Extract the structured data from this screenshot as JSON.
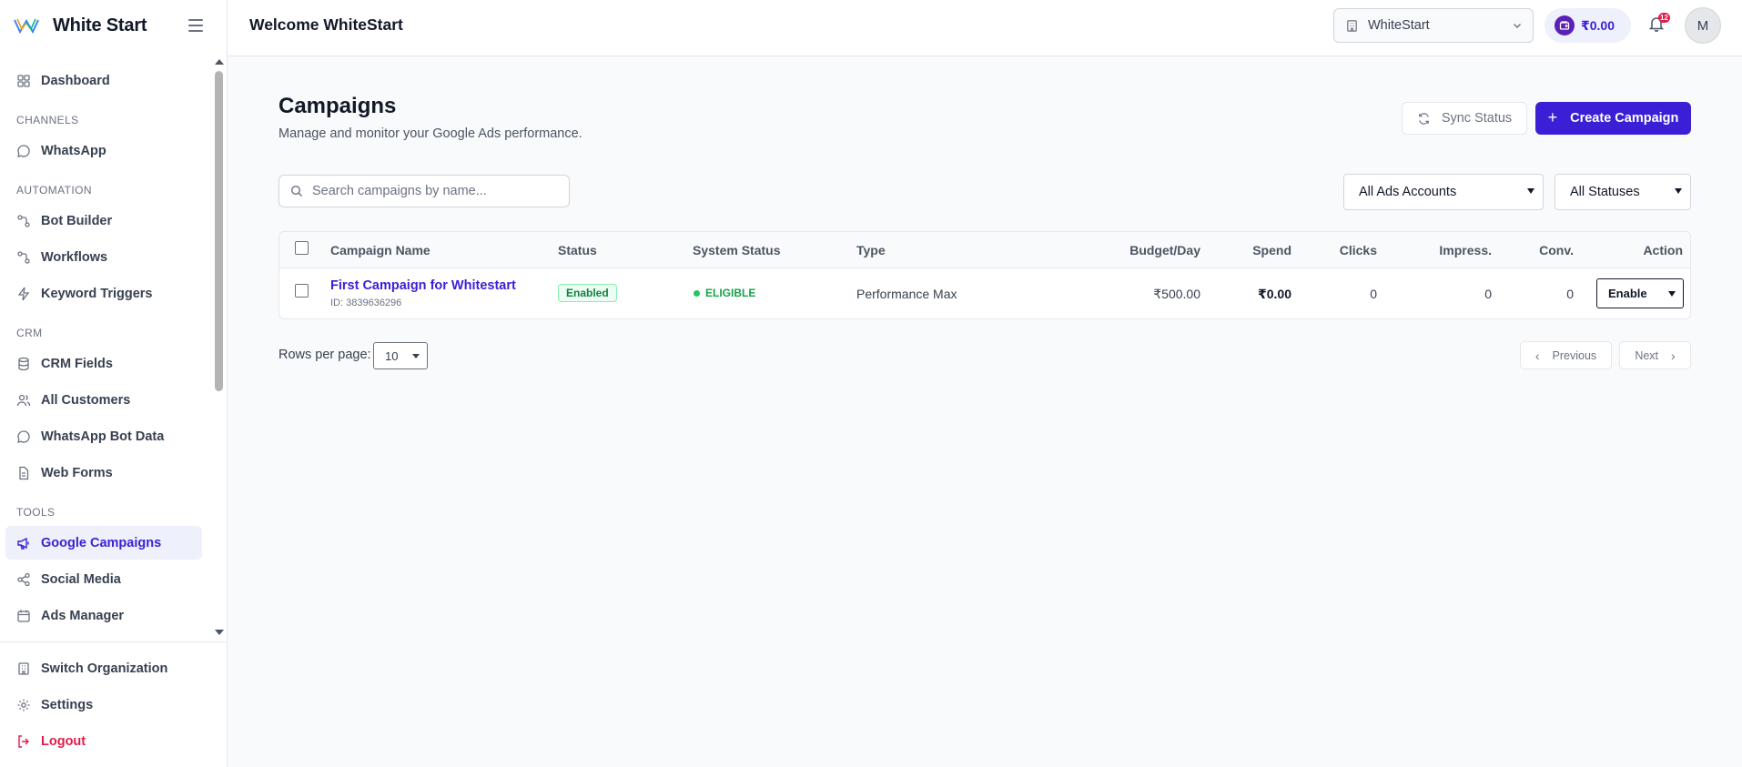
{
  "app": {
    "name": "White Start"
  },
  "sidebar": {
    "top_item": {
      "label": "Dashboard",
      "icon": "dashboard-icon"
    },
    "sections": {
      "channels": "CHANNELS",
      "automation": "AUTOMATION",
      "crm": "CRM",
      "tools": "TOOLS"
    },
    "items": {
      "whatsapp": "WhatsApp",
      "bot_builder": "Bot Builder",
      "workflows": "Workflows",
      "keyword_triggers": "Keyword Triggers",
      "crm_fields": "CRM Fields",
      "all_customers": "All Customers",
      "whatsapp_bot_data": "WhatsApp Bot Data",
      "web_forms": "Web Forms",
      "google_campaigns": "Google Campaigns",
      "social_media": "Social Media",
      "ads_manager": "Ads Manager"
    },
    "active_item": "Google Campaigns",
    "bottom": {
      "switch_org": "Switch Organization",
      "settings": "Settings",
      "logout": "Logout"
    }
  },
  "header": {
    "welcome": "Welcome WhiteStart",
    "org_select": "WhiteStart",
    "wallet_amount": "₹0.00",
    "notification_count": "12",
    "avatar_initial": "M"
  },
  "main": {
    "title": "Campaigns",
    "subtitle": "Manage and monitor your Google Ads performance.",
    "sync_button": "Sync Status",
    "create_button": "Create Campaign",
    "search_placeholder": "Search campaigns by name...",
    "filter_accounts": "All Ads Accounts",
    "filter_status": "All Statuses"
  },
  "table": {
    "columns": {
      "name": "Campaign Name",
      "status": "Status",
      "system_status": "System Status",
      "type": "Type",
      "budget": "Budget/Day",
      "spend": "Spend",
      "clicks": "Clicks",
      "impressions": "Impress.",
      "conversions": "Conv.",
      "action": "Action"
    },
    "rows": [
      {
        "name": "First Campaign for Whitestart",
        "id": "ID: 3839636296",
        "status": "Enabled",
        "system_status": "ELIGIBLE",
        "type": "Performance Max",
        "budget": "₹500.00",
        "spend": "₹0.00",
        "clicks": "0",
        "impressions": "0",
        "conversions": "0",
        "action": "Enable"
      }
    ]
  },
  "pagination": {
    "rows_label": "Rows per page:",
    "rows_value": "10",
    "previous": "Previous",
    "next": "Next"
  },
  "colors": {
    "accent": "#3b1fd6",
    "active_bg": "#eef0fb",
    "success": "#16a34a",
    "danger": "#e11d48"
  }
}
